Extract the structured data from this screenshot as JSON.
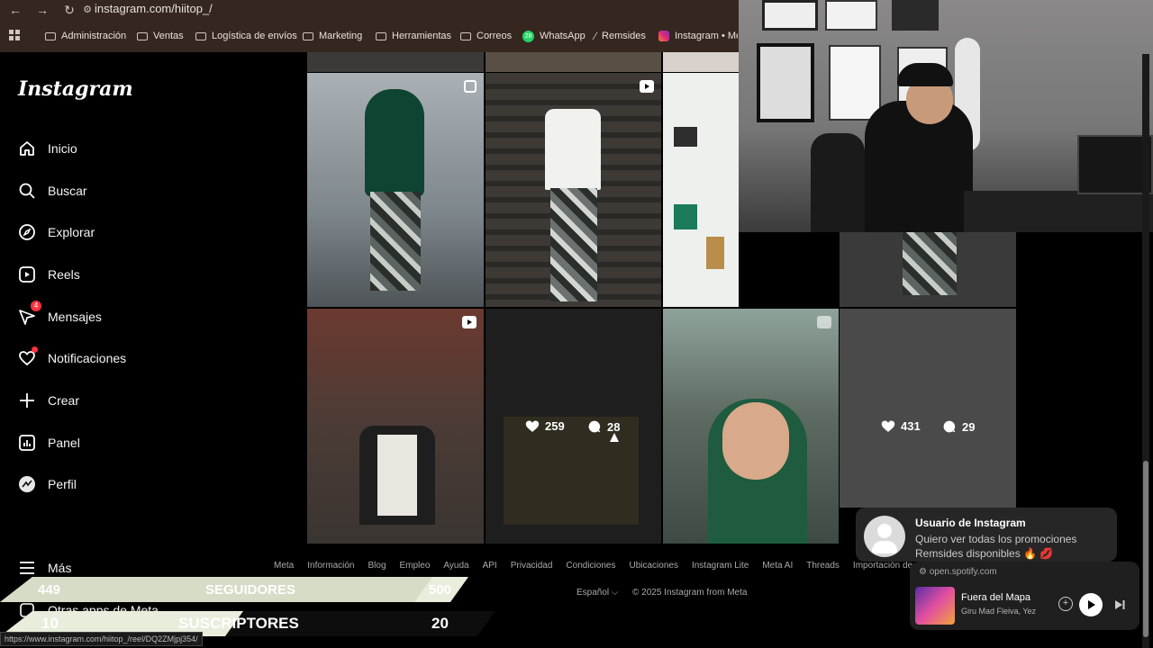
{
  "browser": {
    "url": "instagram.com/hiitop_/",
    "bookmarks": [
      "Administración",
      "Ventas",
      "Logística de envíos",
      "Marketing",
      "Herramientas",
      "Correos",
      "WhatsApp",
      "Remsides",
      "Instagram • Mensajes"
    ],
    "whatsapp_badge": "28",
    "status_url": "https://www.instagram.com/hiitop_/reel/DQ2ZMjpj354/"
  },
  "sidebar": {
    "logo": "Instagram",
    "items": [
      {
        "label": "Inicio",
        "icon": "home-icon"
      },
      {
        "label": "Buscar",
        "icon": "search-icon"
      },
      {
        "label": "Explorar",
        "icon": "compass-icon"
      },
      {
        "label": "Reels",
        "icon": "reels-icon"
      },
      {
        "label": "Mensajes",
        "icon": "messenger-icon",
        "badge": "4"
      },
      {
        "label": "Notificaciones",
        "icon": "heart-icon"
      },
      {
        "label": "Crear",
        "icon": "plus-icon"
      },
      {
        "label": "Panel",
        "icon": "dashboard-icon"
      },
      {
        "label": "Perfil",
        "icon": "avatar-icon"
      }
    ],
    "more": "Más",
    "other_apps": "Otras apps de Meta"
  },
  "grid": {
    "hovered_post": {
      "likes": "259",
      "comments": "28"
    },
    "last_post": {
      "likes": "431",
      "comments": "29"
    }
  },
  "footer": {
    "links": [
      "Meta",
      "Información",
      "Blog",
      "Empleo",
      "Ayuda",
      "API",
      "Privacidad",
      "Condiciones",
      "Ubicaciones",
      "Instagram Lite",
      "Meta AI",
      "Threads",
      "Importación de contactos"
    ],
    "language": "Español",
    "copyright": "© 2025 Instagram from Meta"
  },
  "notification": {
    "title": "Usuario de Instagram",
    "body": "Quiero ver todas los promociones Remsides disponibles 🔥 💋"
  },
  "spotify": {
    "domain": "open.spotify.com",
    "track": "Fuera del Mapa",
    "artist": "Giru Mad Fleiva, Yez"
  },
  "stream": {
    "followers_current": "449",
    "followers_label": "SEGUIDORES",
    "followers_goal": "500",
    "subs_current": "10",
    "subs_label": "SUSCRIPTORES",
    "subs_goal": "20"
  }
}
